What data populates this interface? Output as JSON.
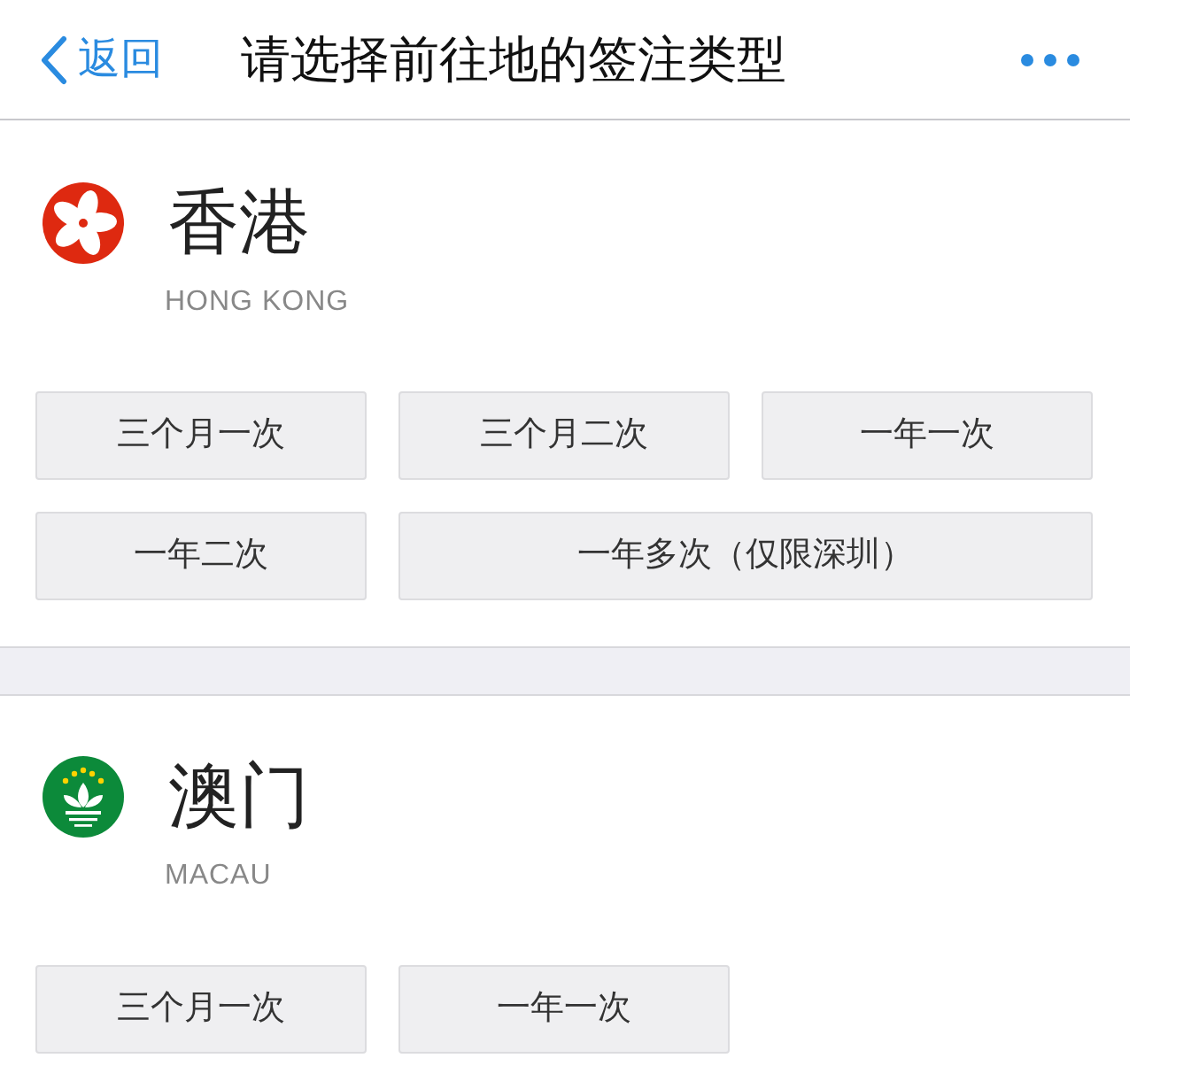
{
  "header": {
    "back_label": "返回",
    "title": "请选择前往地的签注类型"
  },
  "regions": [
    {
      "name": "香港",
      "name_en": "HONG KONG",
      "options": [
        {
          "label": "三个月一次"
        },
        {
          "label": "三个月二次"
        },
        {
          "label": "一年一次"
        },
        {
          "label": "一年二次"
        },
        {
          "label": "一年多次（仅限深圳）"
        }
      ]
    },
    {
      "name": "澳门",
      "name_en": "MACAU",
      "options": [
        {
          "label": "三个月一次"
        },
        {
          "label": "一年一次"
        }
      ]
    }
  ]
}
